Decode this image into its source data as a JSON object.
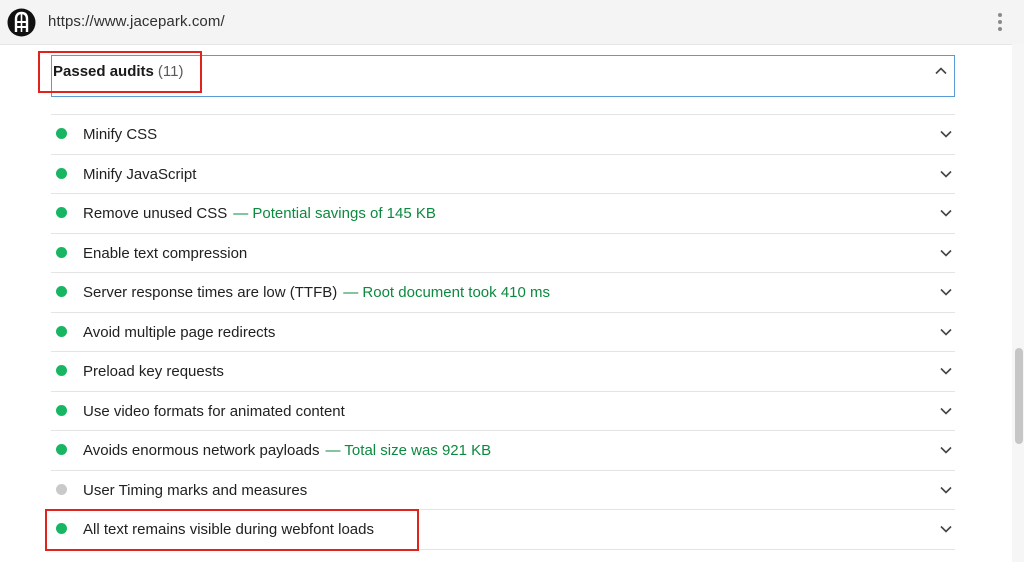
{
  "browser": {
    "url": "https://www.jacepark.com/",
    "site_icon": "jacepark-logo-icon",
    "menu_icon": "kebab-menu-icon"
  },
  "passed_audits": {
    "title": "Passed audits",
    "count": "(11)",
    "expanded": true,
    "chevron_icon": "chevron-up-icon"
  },
  "colors": {
    "pass": "#18b663",
    "info": "#c9c9c9",
    "savings_text": "#0b8a3f",
    "highlight": "#e0241b",
    "focus_border": "#5b9bd5"
  },
  "audits": [
    {
      "title": "Minify CSS",
      "detail": "",
      "status": "pass"
    },
    {
      "title": "Minify JavaScript",
      "detail": "",
      "status": "pass"
    },
    {
      "title": "Remove unused CSS",
      "detail": "— Potential savings of 145 KB",
      "status": "pass"
    },
    {
      "title": "Enable text compression",
      "detail": "",
      "status": "pass"
    },
    {
      "title": "Server response times are low (TTFB)",
      "detail": "— Root document took 410 ms",
      "status": "pass"
    },
    {
      "title": "Avoid multiple page redirects",
      "detail": "",
      "status": "pass"
    },
    {
      "title": "Preload key requests",
      "detail": "",
      "status": "pass"
    },
    {
      "title": "Use video formats for animated content",
      "detail": "",
      "status": "pass"
    },
    {
      "title": "Avoids enormous network payloads",
      "detail": "— Total size was 921 KB",
      "status": "pass"
    },
    {
      "title": "User Timing marks and measures",
      "detail": "",
      "status": "info"
    },
    {
      "title": "All text remains visible during webfont loads",
      "detail": "",
      "status": "pass"
    }
  ]
}
